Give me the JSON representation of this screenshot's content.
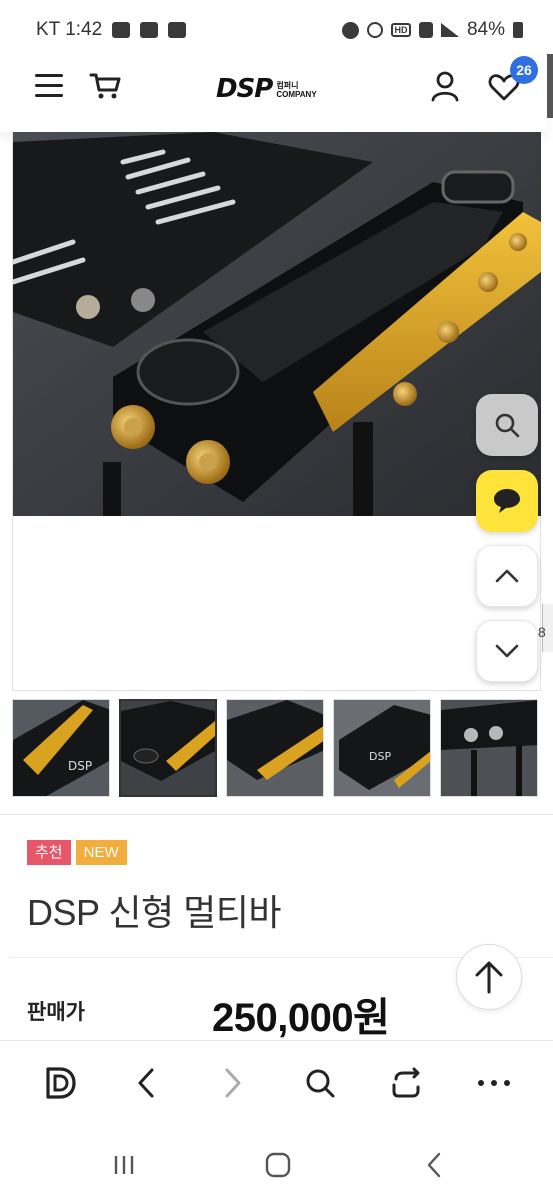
{
  "status_bar": {
    "carrier_time": "KT 1:42",
    "battery": "84%",
    "icons": [
      "gallery-icon",
      "game-icon",
      "youtube-icon",
      "alarm-icon",
      "mute-icon",
      "hd-icon",
      "5g-icon",
      "signal-icon",
      "battery-icon"
    ]
  },
  "header": {
    "logo_text": "DSP",
    "logo_sub_top": "컴퍼니",
    "logo_sub_bottom": "COMPANY",
    "wishlist_count": "26"
  },
  "product": {
    "tags": [
      {
        "label": "추천",
        "color": "#e8566a"
      },
      {
        "label": "NEW",
        "color": "#f1ae3c"
      }
    ],
    "title": "DSP 신형 멀티바",
    "price_label": "판매가",
    "price": "250,000원",
    "thumbnail_count": 5,
    "active_thumbnail": 2
  },
  "side_counter": "8",
  "colors": {
    "badge": "#2f6fe0",
    "talk_button": "#fde33a",
    "search_button": "#c9c9c9",
    "accent_gold": "#d9a320"
  }
}
